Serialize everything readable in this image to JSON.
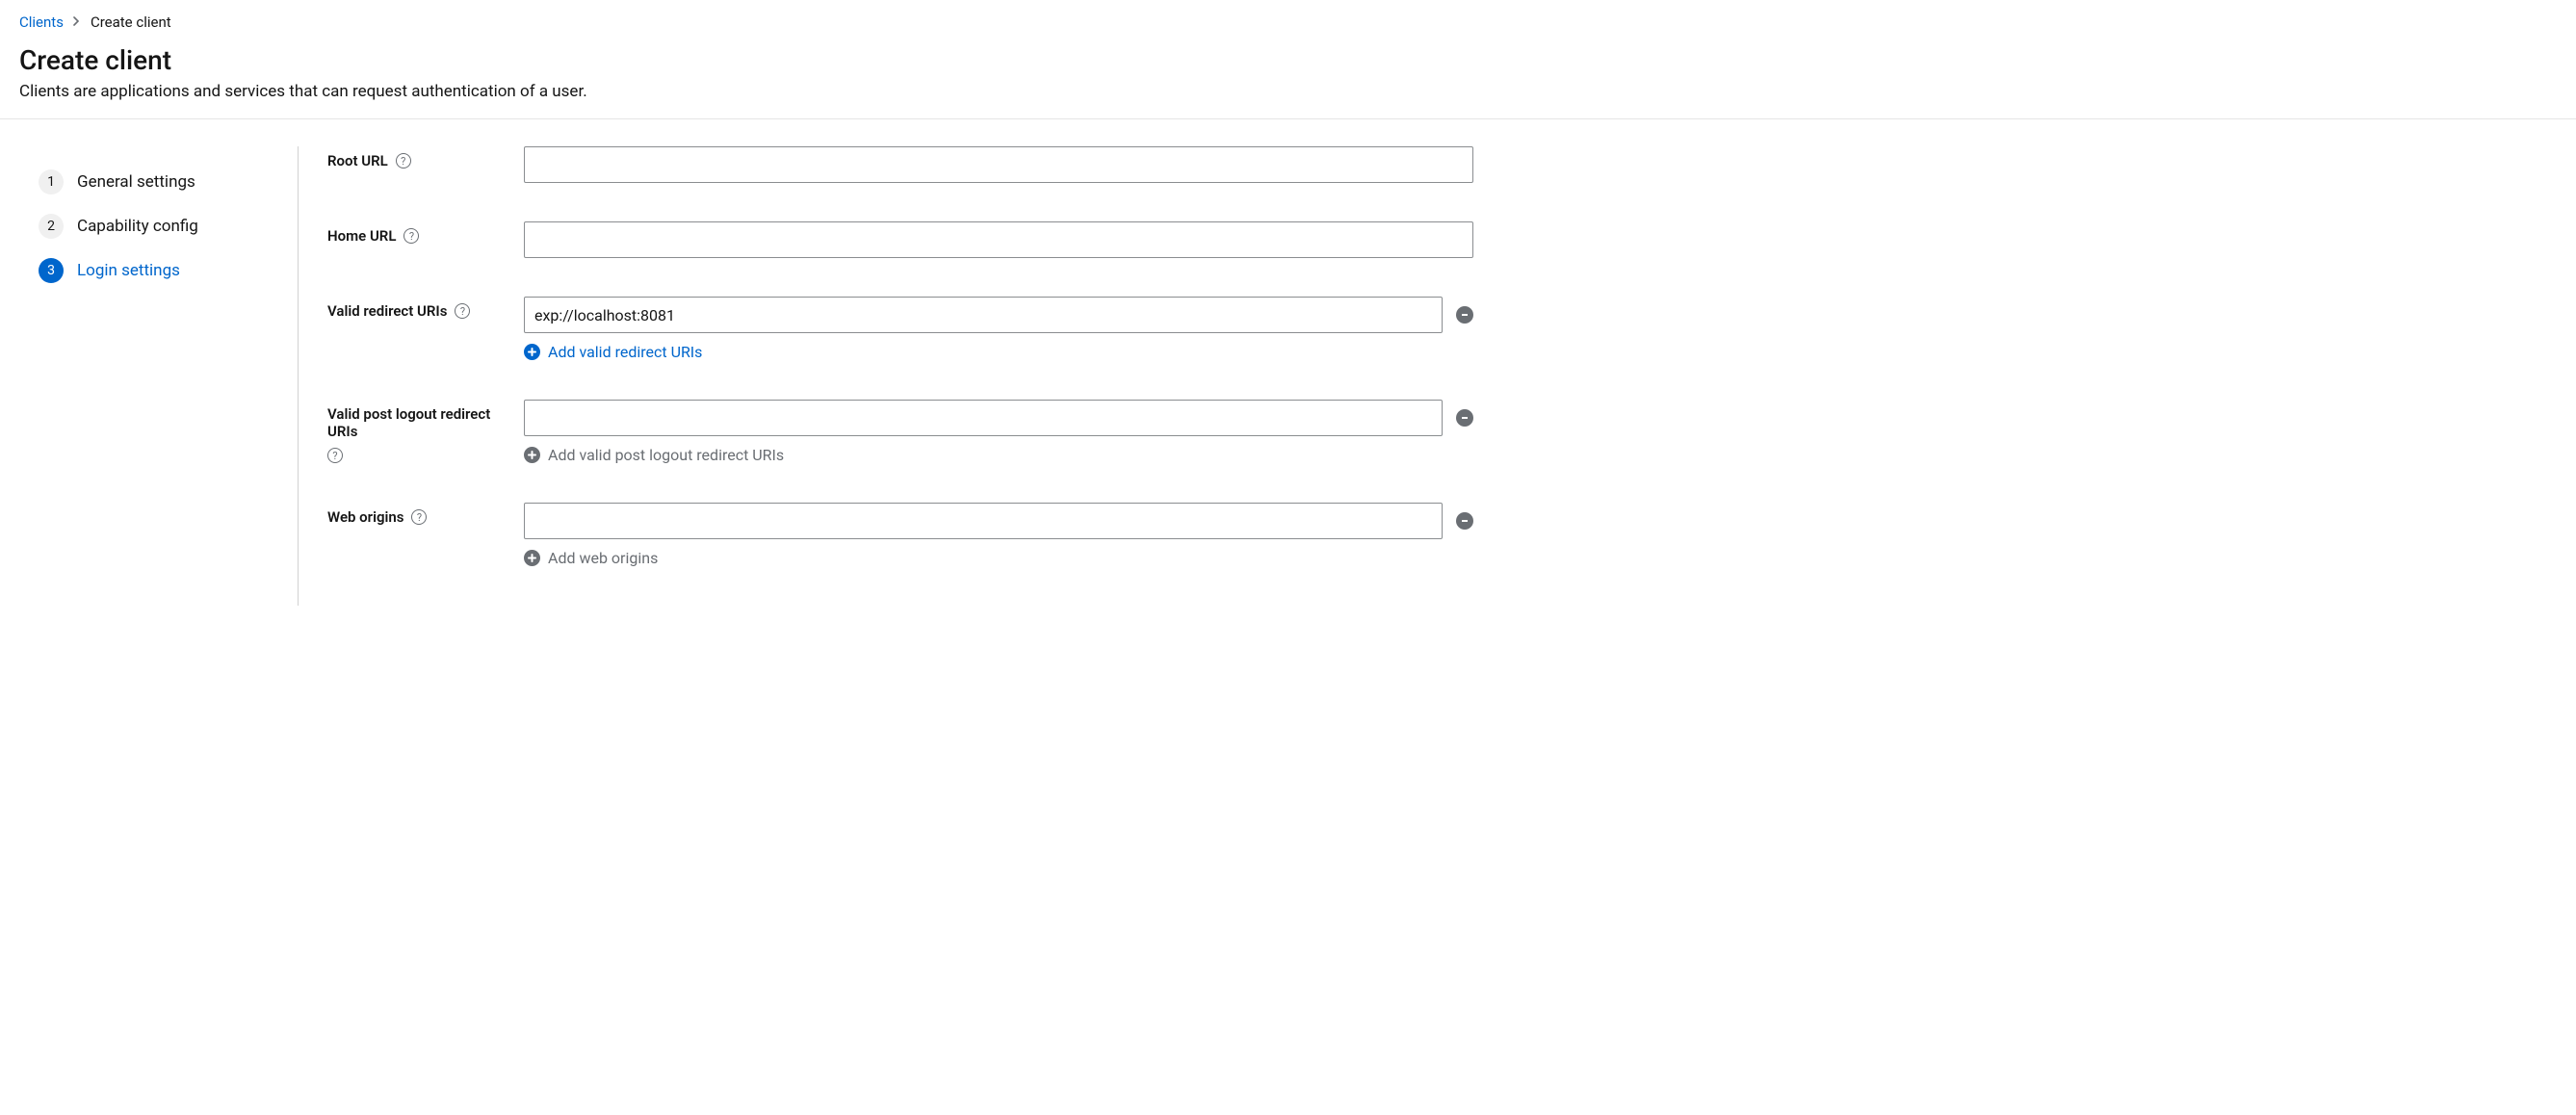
{
  "breadcrumb": {
    "parent": "Clients",
    "current": "Create client"
  },
  "page": {
    "title": "Create client",
    "subtitle": "Clients are applications and services that can request authentication of a user."
  },
  "steps": [
    {
      "num": "1",
      "label": "General settings",
      "active": false
    },
    {
      "num": "2",
      "label": "Capability config",
      "active": false
    },
    {
      "num": "3",
      "label": "Login settings",
      "active": true
    }
  ],
  "form": {
    "rootUrl": {
      "label": "Root URL",
      "value": ""
    },
    "homeUrl": {
      "label": "Home URL",
      "value": ""
    },
    "redirectUris": {
      "label": "Valid redirect URIs",
      "values": [
        "exp://localhost:8081"
      ],
      "addLabel": "Add valid redirect URIs",
      "addEnabled": true
    },
    "postLogout": {
      "label": "Valid post logout redirect URIs",
      "values": [
        ""
      ],
      "addLabel": "Add valid post logout redirect URIs",
      "addEnabled": false
    },
    "webOrigins": {
      "label": "Web origins",
      "values": [
        ""
      ],
      "addLabel": "Add web origins",
      "addEnabled": false
    }
  }
}
